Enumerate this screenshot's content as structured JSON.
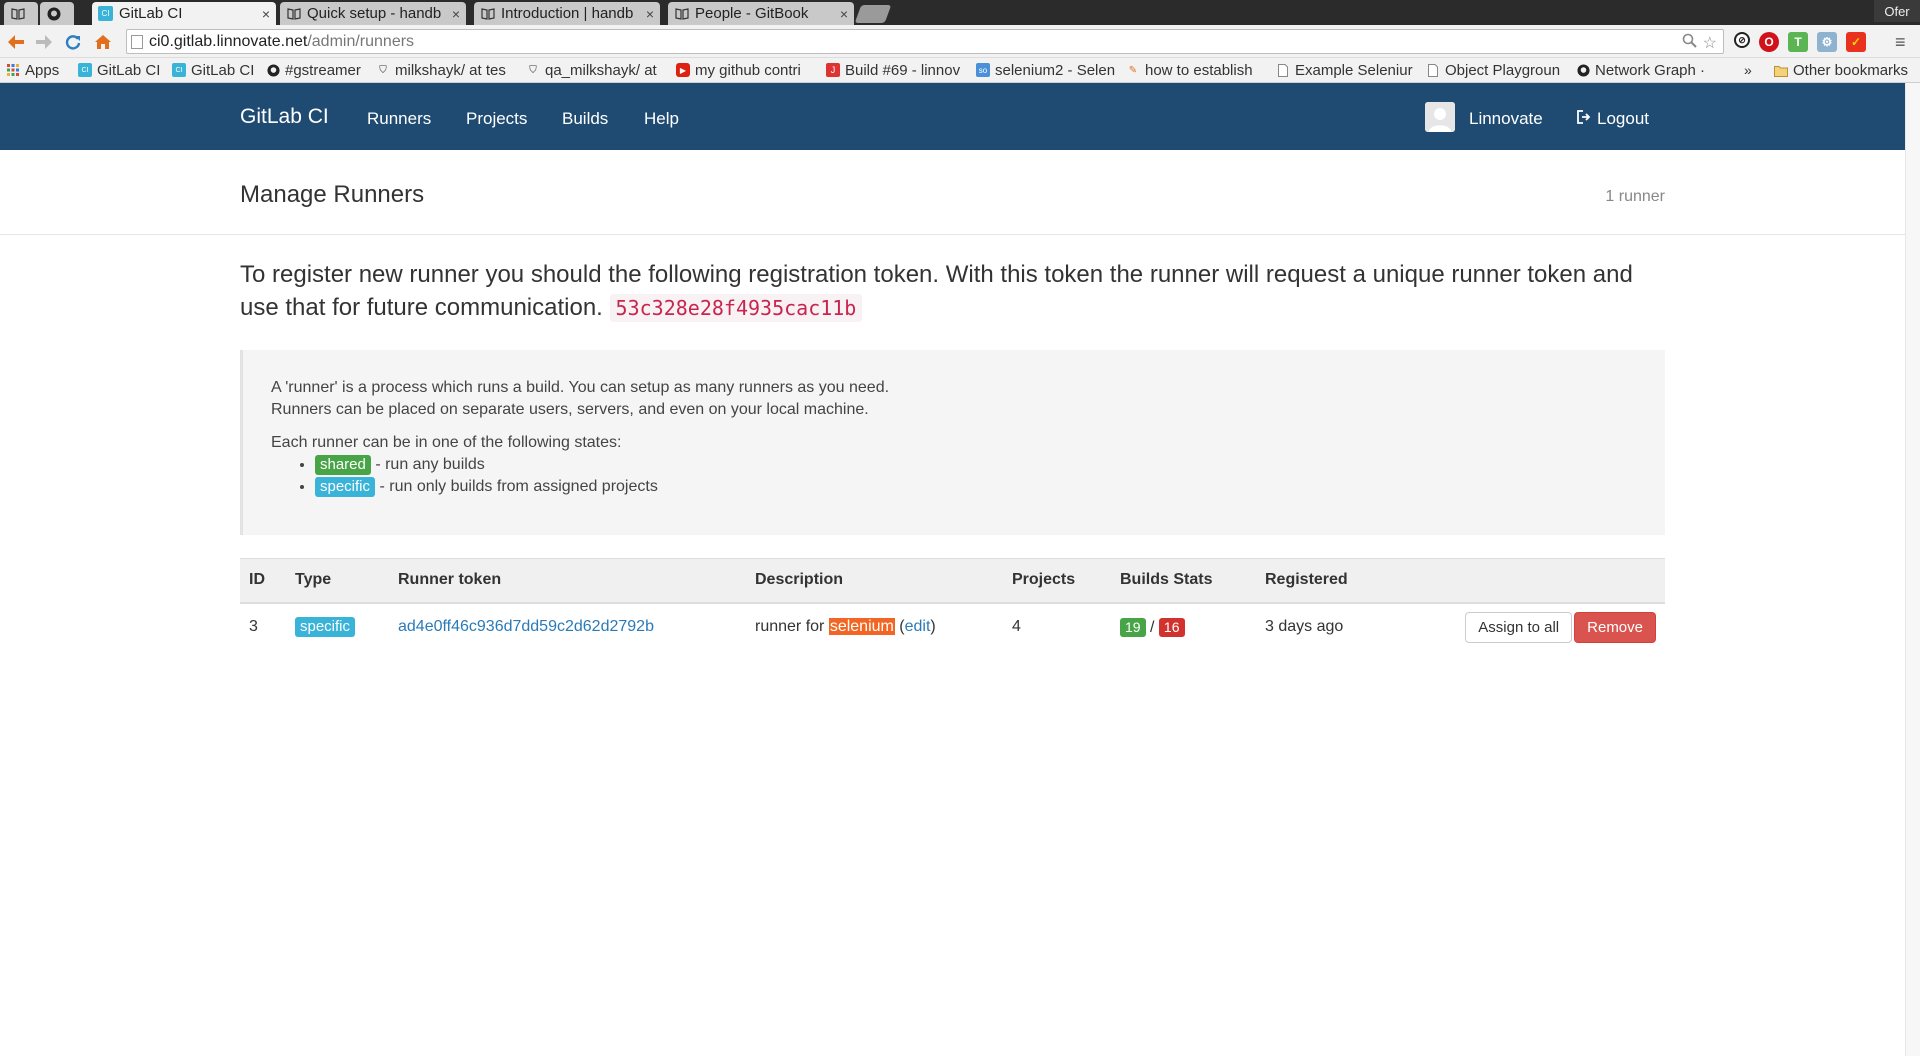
{
  "browser": {
    "tabs": [
      {
        "label": "",
        "icon": "book-icon"
      },
      {
        "label": "",
        "icon": "github-icon"
      },
      {
        "label": "GitLab CI",
        "icon": "gitlab-ci-icon",
        "active": true
      },
      {
        "label": "Quick setup - handb",
        "icon": "book-icon"
      },
      {
        "label": "Introduction | handb",
        "icon": "book-icon"
      },
      {
        "label": "People - GitBook",
        "icon": "book-icon"
      }
    ],
    "profile": "Ofer",
    "url_host": "ci0.gitlab.linnovate.net",
    "url_path": "/admin/runners",
    "bookmarks": [
      {
        "label": "Apps",
        "icon": "apps-grid-icon"
      },
      {
        "label": "GitLab CI",
        "icon": "gitlab-ci-icon"
      },
      {
        "label": "GitLab CI",
        "icon": "gitlab-ci-icon"
      },
      {
        "label": "#gstreamer",
        "icon": "github-icon"
      },
      {
        "label": "milkshayk/ at tes",
        "icon": "shield-icon"
      },
      {
        "label": "qa_milkshayk/ at",
        "icon": "shield-icon"
      },
      {
        "label": "my github contri",
        "icon": "youtube-icon"
      },
      {
        "label": "Build #69 - linnov",
        "icon": "jenkins-icon"
      },
      {
        "label": "selenium2 - Selen",
        "icon": "stackoverflow-icon"
      },
      {
        "label": "how to establish",
        "icon": "stackexchange-icon"
      },
      {
        "label": "Example Seleniur",
        "icon": "page-icon"
      },
      {
        "label": "Object Playgroun",
        "icon": "page-icon"
      },
      {
        "label": "Network Graph · ",
        "icon": "github-icon"
      }
    ],
    "bookmarks_more": "»",
    "other_bookmarks": "Other bookmarks"
  },
  "navbar": {
    "brand": "GitLab CI",
    "links": [
      "Runners",
      "Projects",
      "Builds",
      "Help"
    ],
    "user": "Linnovate",
    "logout": "Logout"
  },
  "header": {
    "title": "Manage Runners",
    "count": "1 runner"
  },
  "registration": {
    "text": "To register new runner you should the following registration token. With this token the runner will request a unique runner token and use that for future communication.",
    "token": "53c328e28f4935cac11b"
  },
  "info": {
    "line1": "A 'runner' is a process which runs a build. You can setup as many runners as you need.",
    "line2": "Runners can be placed on separate users, servers, and even on your local machine.",
    "states_intro": "Each runner can be in one of the following states:",
    "states": [
      {
        "label": "shared",
        "desc": " - run any builds"
      },
      {
        "label": "specific",
        "desc": " - run only builds from assigned projects"
      }
    ]
  },
  "table": {
    "headers": [
      "ID",
      "Type",
      "Runner token",
      "Description",
      "Projects",
      "Builds Stats",
      "Registered",
      ""
    ],
    "rows": [
      {
        "id": "3",
        "type": "specific",
        "token": "ad4e0ff46c936d7dd59c2d62d2792b",
        "desc_prefix": "runner for ",
        "desc_highlight": "selenium",
        "desc_edit_open": " (",
        "desc_edit": "edit",
        "desc_edit_close": ")",
        "projects": "4",
        "builds_success": "19",
        "builds_sep": " / ",
        "builds_failed": "16",
        "registered": "3 days ago",
        "assign_label": "Assign to all",
        "remove_label": "Remove"
      }
    ]
  },
  "colors": {
    "navbar_bg": "#1f4b73",
    "shared_label": "#47a447",
    "specific_label": "#39b3d7",
    "danger": "#d9534f",
    "highlight": "#f26522",
    "link": "#2a7ab8"
  }
}
